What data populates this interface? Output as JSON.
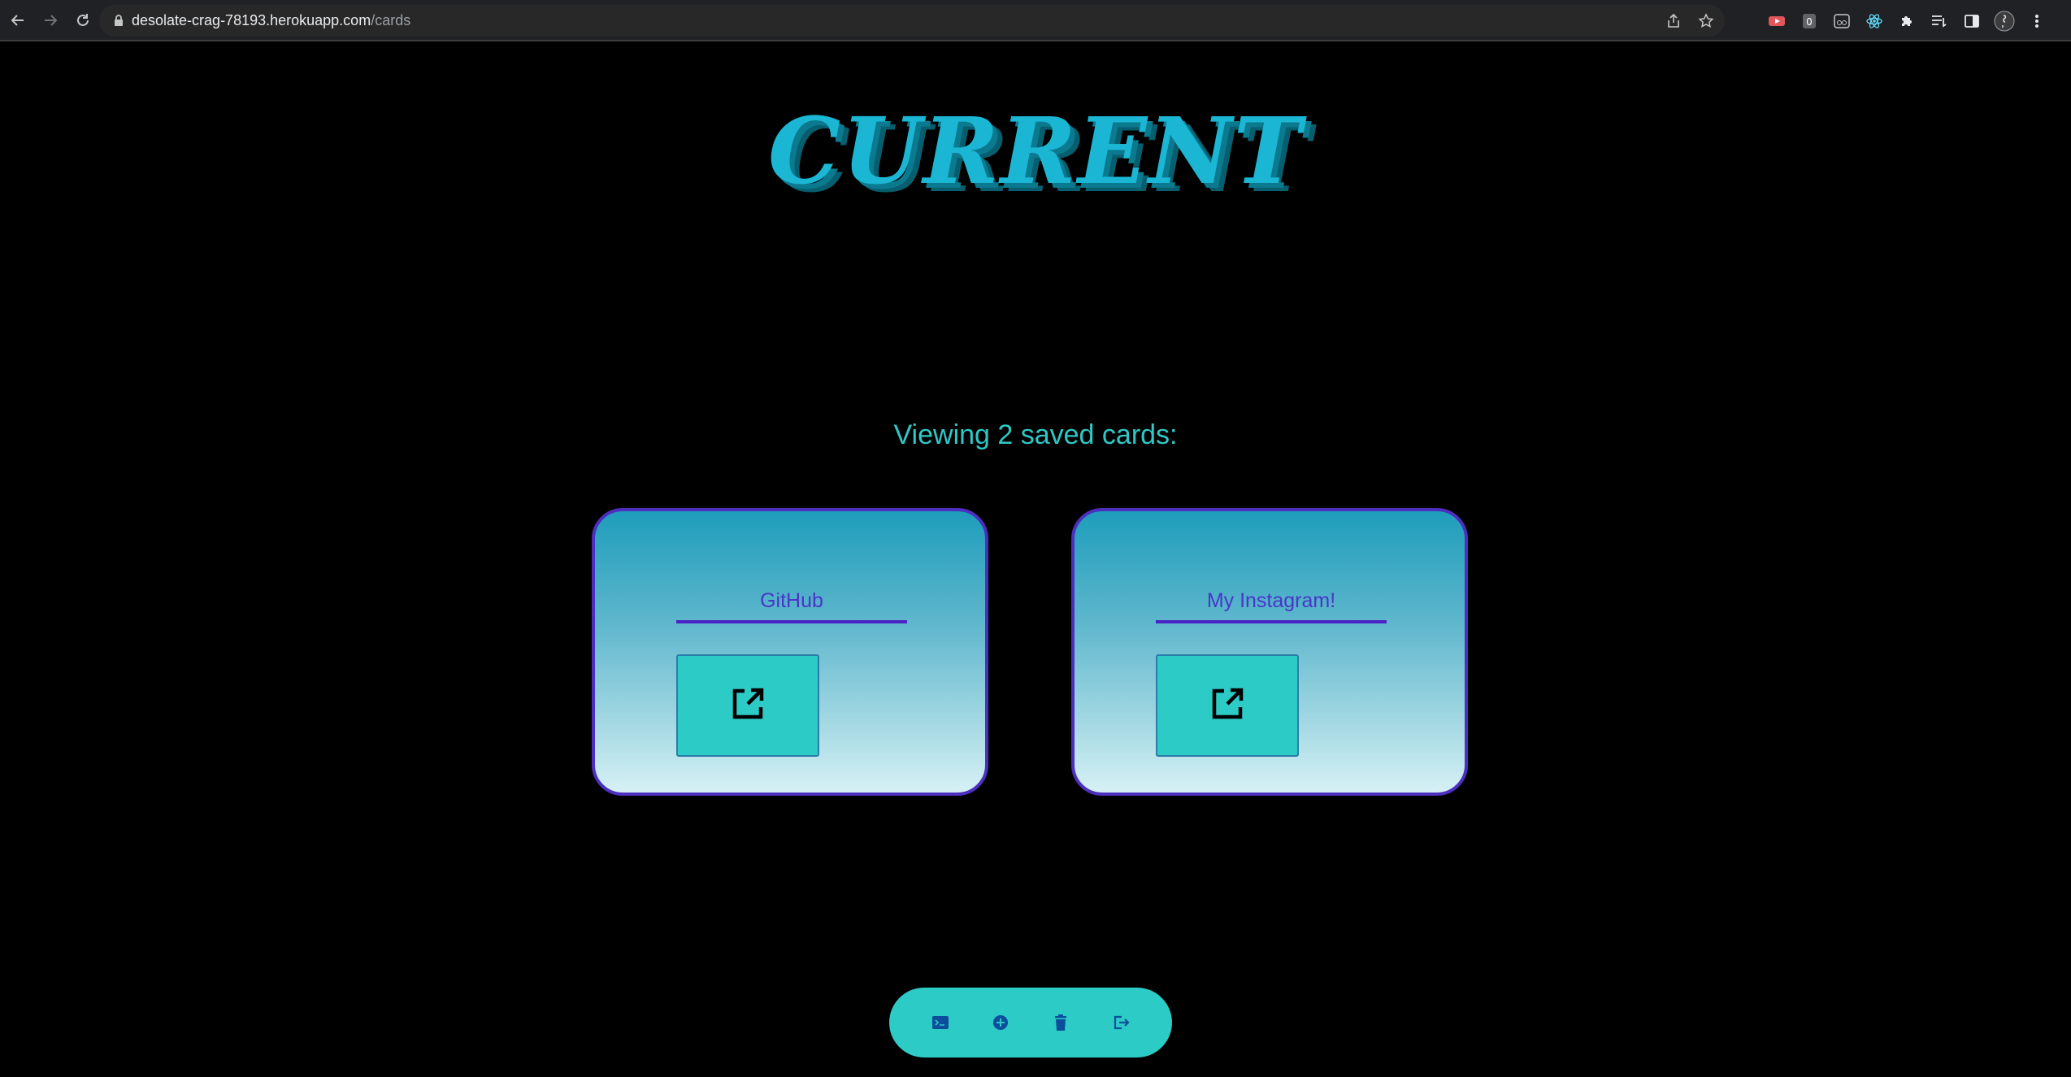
{
  "browser": {
    "url_domain": "desolate-crag-78193.herokuapp.com",
    "url_path": "/cards",
    "nav_icons": [
      "back-icon",
      "forward-icon",
      "reload-icon"
    ],
    "extension_badge": "0"
  },
  "page": {
    "logo_text": "CURRENT",
    "count_text": "Viewing 2 saved cards:",
    "cards": [
      {
        "title": "GitHub"
      },
      {
        "title": "My Instagram!"
      }
    ]
  },
  "colors": {
    "accent_teal": "#2ccbc6",
    "logo_blue": "#1ab6d4",
    "card_border": "#4d2fbf",
    "title_purple": "#4a35c9"
  },
  "toolbar": {
    "icons": [
      "terminal-icon",
      "add-circle-icon",
      "trash-icon",
      "logout-icon"
    ]
  }
}
